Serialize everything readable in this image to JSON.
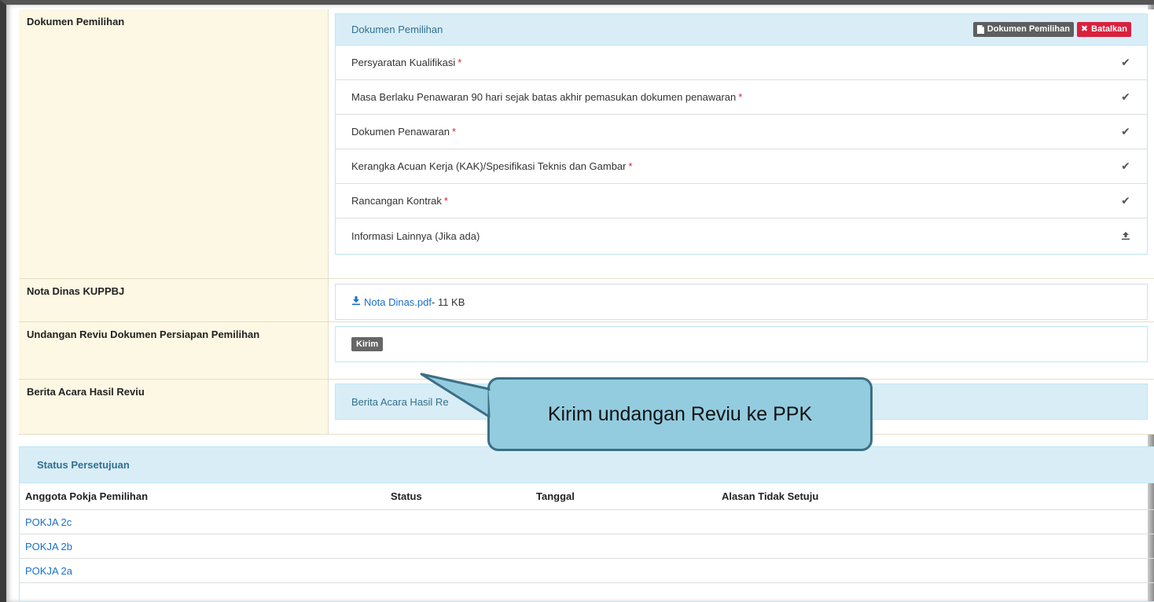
{
  "form": {
    "dokumen_label": "Dokumen Pemilihan",
    "dokumen_panel": {
      "title": "Dokumen Pemilihan",
      "btn_dokumen": "Dokumen Pemilihan",
      "btn_batalkan": "Batalkan",
      "items": [
        {
          "label": "Persyaratan Kualifikasi",
          "required": "*",
          "icon": "check-icon"
        },
        {
          "label": "Masa Berlaku Penawaran 90 hari sejak batas akhir pemasukan dokumen penawaran",
          "required": "*",
          "icon": "check-icon"
        },
        {
          "label": "Dokumen Penawaran",
          "required": "*",
          "icon": "check-icon"
        },
        {
          "label": "Kerangka Acuan Kerja (KAK)/Spesifikasi Teknis dan Gambar",
          "required": "*",
          "icon": "check-icon"
        },
        {
          "label": "Rancangan Kontrak",
          "required": "*",
          "icon": "check-icon"
        },
        {
          "label": "Informasi Lainnya (Jika ada)",
          "required": "",
          "icon": "upload-icon"
        }
      ]
    },
    "nota_label": "Nota Dinas KUPPBJ",
    "nota_file": "Nota Dinas.pdf",
    "nota_size": " - 11 KB",
    "undangan_label": "Undangan Reviu Dokumen Persiapan Pemilihan",
    "kirim_label": "Kirim",
    "berita_label": "Berita Acara Hasil Reviu",
    "berita_panel_text": "Berita Acara Hasil Re"
  },
  "status": {
    "title": "Status Persetujuan",
    "columns": [
      "Anggota Pokja Pemilihan",
      "Status",
      "Tanggal",
      "Alasan Tidak Setuju"
    ],
    "rows": [
      {
        "member": "POKJA 2c"
      },
      {
        "member": "POKJA 2b"
      },
      {
        "member": "POKJA 2a"
      }
    ]
  },
  "callout": {
    "text": "Kirim undangan Reviu ke PPK"
  },
  "colors": {
    "label_bg": "#fcf8e3",
    "panel_head_bg": "#d9edf7",
    "danger": "#d9213d",
    "link": "#1a6fc9",
    "callout_bg": "#93ccdf"
  }
}
